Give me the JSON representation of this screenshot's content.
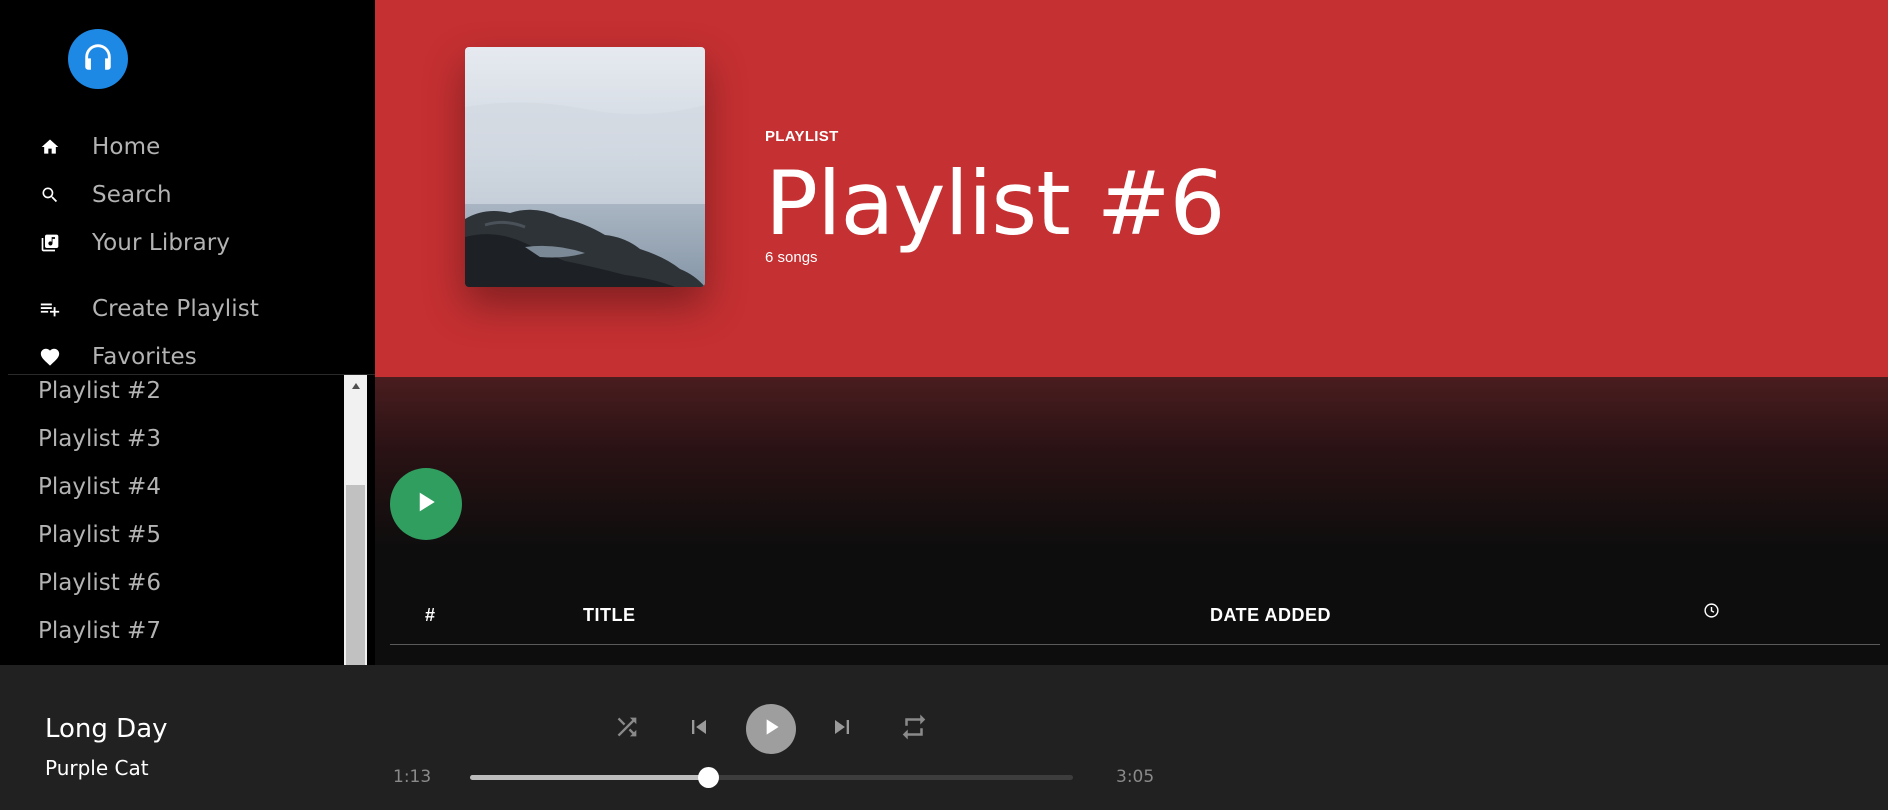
{
  "sidebar": {
    "nav": [
      {
        "label": "Home",
        "icon": "home-icon"
      },
      {
        "label": "Search",
        "icon": "search-icon"
      },
      {
        "label": "Your Library",
        "icon": "library-icon"
      }
    ],
    "actions": [
      {
        "label": "Create Playlist",
        "icon": "playlist-add-icon"
      },
      {
        "label": "Favorites",
        "icon": "heart-icon"
      }
    ],
    "playlists": [
      "Playlist #2",
      "Playlist #3",
      "Playlist #4",
      "Playlist #5",
      "Playlist #6",
      "Playlist #7"
    ]
  },
  "header": {
    "type": "PLAYLIST",
    "title": "Playlist #6",
    "count": "6 songs",
    "color": "#c53032"
  },
  "table": {
    "col_num": "#",
    "col_title": "TITLE",
    "col_date": "DATE ADDED",
    "col_duration_icon": "clock-icon"
  },
  "player": {
    "title": "Long Day",
    "artist": "Purple Cat",
    "elapsed": "1:13",
    "duration": "3:05",
    "progress": 0.395
  },
  "colors": {
    "accent_play": "#2f9e5f",
    "logo": "#1e88e5"
  }
}
